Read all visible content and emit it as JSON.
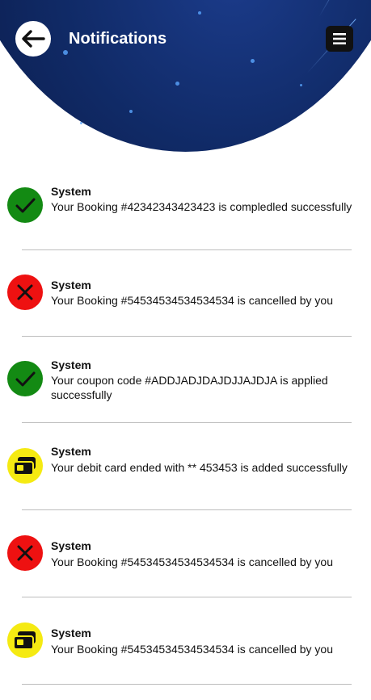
{
  "header": {
    "title": "Notifications"
  },
  "icons": {
    "back": "arrow-left-icon",
    "menu": "menu-icon"
  },
  "notifications": [
    {
      "sender": "System",
      "message": "Your Booking #42342343423423 is compledled successfully",
      "status": "success"
    },
    {
      "sender": "System",
      "message": "Your Booking #54534534534534534 is cancelled by you",
      "status": "cancel"
    },
    {
      "sender": "System",
      "message": "Your coupon code #ADDJADJDAJDJJAJDJA is applied successfully",
      "status": "success"
    },
    {
      "sender": "System",
      "message": "Your debit card ended with ** 453453 is added successfully",
      "status": "card"
    },
    {
      "sender": "System",
      "message": "Your Booking #54534534534534534 is cancelled by you",
      "status": "cancel"
    },
    {
      "sender": "System",
      "message": "Your Booking #54534534534534534 is cancelled by you",
      "status": "card"
    }
  ],
  "colors": {
    "success": "#138a13",
    "cancel": "#ee1111",
    "card": "#f5ea12",
    "header": "#0b1a47"
  }
}
